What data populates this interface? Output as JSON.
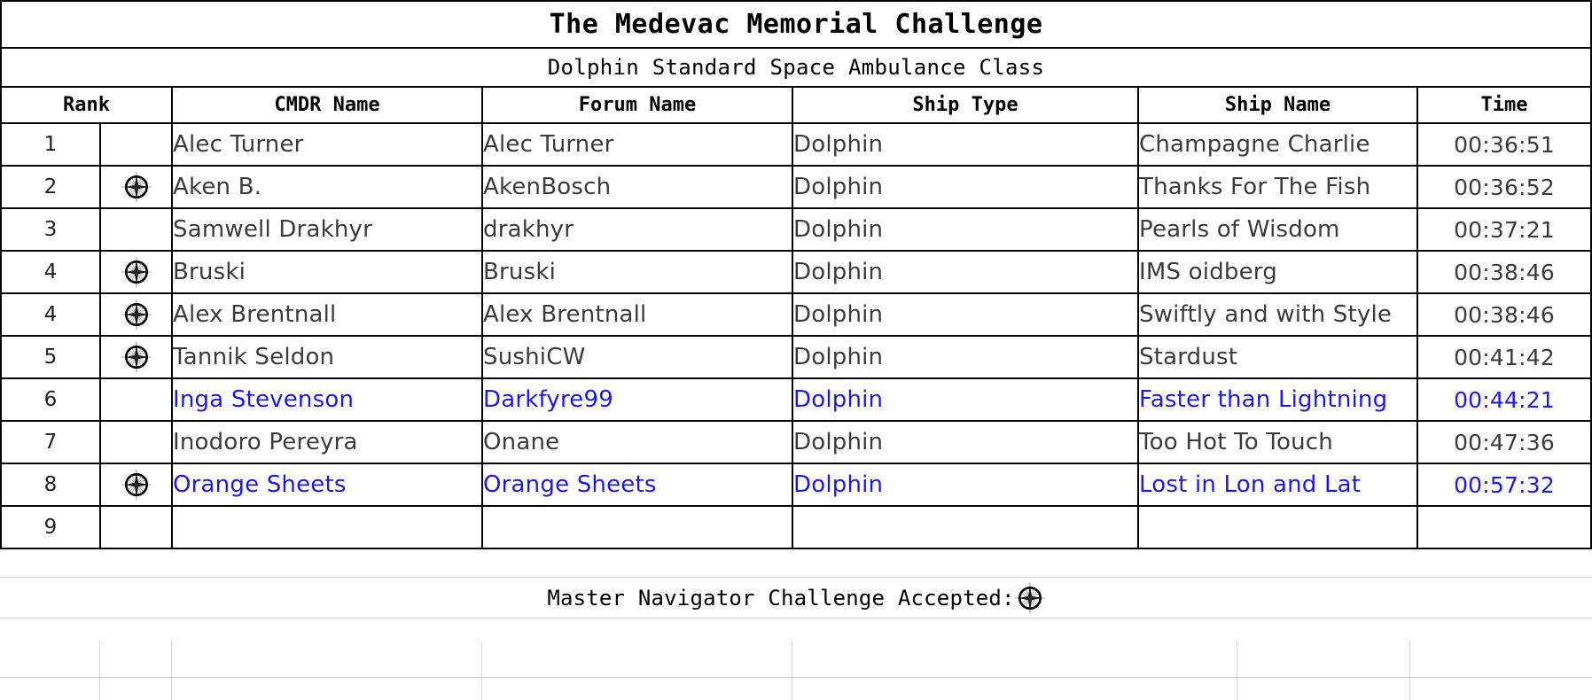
{
  "header": {
    "title": "The Medevac Memorial Challenge",
    "subtitle": "Dolphin Standard Space Ambulance Class"
  },
  "table": {
    "columns": [
      {
        "key": "rank",
        "label": "Rank"
      },
      {
        "key": "flag",
        "label": ""
      },
      {
        "key": "cmdr_name",
        "label": "CMDR Name"
      },
      {
        "key": "forum_name",
        "label": "Forum Name"
      },
      {
        "key": "ship_type",
        "label": "Ship Type"
      },
      {
        "key": "ship_name",
        "label": "Ship Name"
      },
      {
        "key": "time",
        "label": "Time"
      }
    ],
    "rows": [
      {
        "rank": "1",
        "flag": "",
        "cmdr_name": "Alec Turner",
        "forum_name": "Alec Turner",
        "ship_type": "Dolphin",
        "ship_name": "Champagne Charlie",
        "time": "00:36:51",
        "highlight": false
      },
      {
        "rank": "2",
        "flag": "compass-rose-icon",
        "cmdr_name": "Aken B.",
        "forum_name": "AkenBosch",
        "ship_type": "Dolphin",
        "ship_name": "Thanks For The Fish",
        "time": "00:36:52",
        "highlight": false
      },
      {
        "rank": "3",
        "flag": "",
        "cmdr_name": "Samwell Drakhyr",
        "forum_name": "drakhyr",
        "ship_type": "Dolphin",
        "ship_name": "Pearls of Wisdom",
        "time": "00:37:21",
        "highlight": false
      },
      {
        "rank": "4",
        "flag": "compass-rose-icon",
        "cmdr_name": "Bruski",
        "forum_name": "Bruski",
        "ship_type": "Dolphin",
        "ship_name": "IMS oidberg",
        "time": "00:38:46",
        "highlight": false
      },
      {
        "rank": "4",
        "flag": "compass-rose-icon",
        "cmdr_name": "Alex Brentnall",
        "forum_name": "Alex Brentnall",
        "ship_type": "Dolphin",
        "ship_name": "Swiftly and with Style",
        "time": "00:38:46",
        "highlight": false
      },
      {
        "rank": "5",
        "flag": "compass-rose-icon",
        "cmdr_name": "Tannik Seldon",
        "forum_name": "SushiCW",
        "ship_type": "Dolphin",
        "ship_name": "Stardust",
        "time": "00:41:42",
        "highlight": false
      },
      {
        "rank": "6",
        "flag": "",
        "cmdr_name": "Inga Stevenson",
        "forum_name": "Darkfyre99",
        "ship_type": "Dolphin",
        "ship_name": "Faster than Lightning",
        "time": "00:44:21",
        "highlight": true
      },
      {
        "rank": "7",
        "flag": "",
        "cmdr_name": "Inodoro Pereyra",
        "forum_name": "Onane",
        "ship_type": "Dolphin",
        "ship_name": "Too Hot To Touch",
        "time": "00:47:36",
        "highlight": false
      },
      {
        "rank": "8",
        "flag": "compass-rose-icon",
        "cmdr_name": "Orange Sheets",
        "forum_name": "Orange Sheets",
        "ship_type": "Dolphin",
        "ship_name": "Lost in Lon and Lat",
        "time": "00:57:32",
        "highlight": true
      },
      {
        "rank": "9",
        "flag": "",
        "cmdr_name": "",
        "forum_name": "",
        "ship_type": "",
        "ship_name": "",
        "time": "",
        "highlight": false
      }
    ]
  },
  "footer": {
    "legend_label": "Master Navigator Challenge Accepted:",
    "legend_icon": "compass-rose-icon"
  },
  "colors": {
    "highlight": "#1a1ae8",
    "text": "#3b3b3b",
    "border": "#000000",
    "gridline": "#d4d4d4"
  }
}
